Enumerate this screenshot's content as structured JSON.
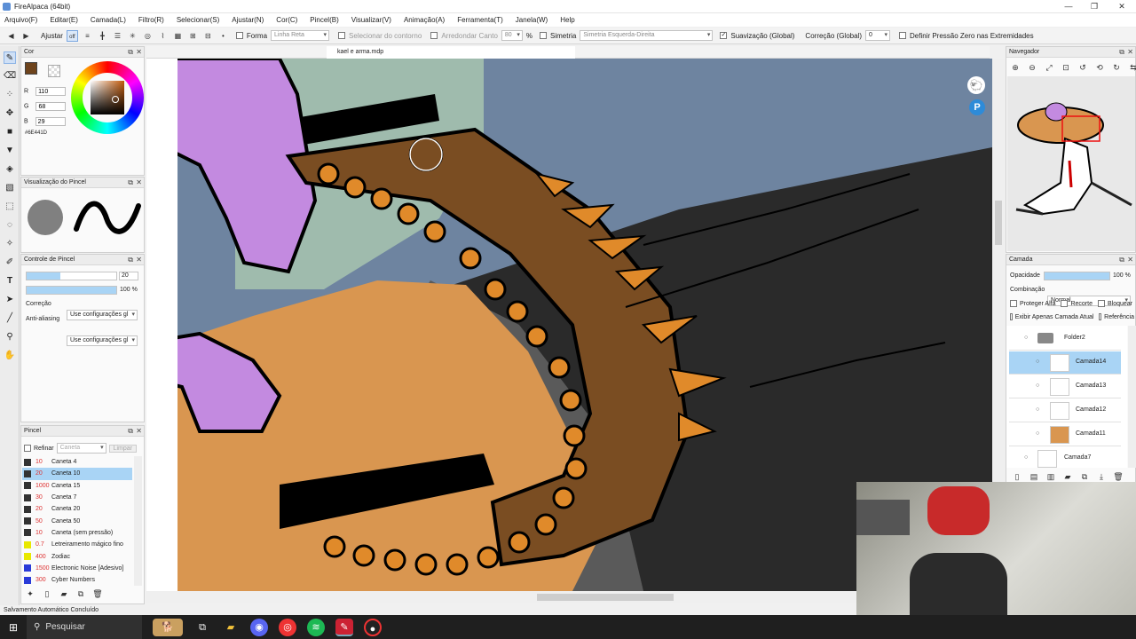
{
  "app": {
    "title": "FireAlpaca (64bit)"
  },
  "menu": [
    "Arquivo(F)",
    "Editar(E)",
    "Camada(L)",
    "Filtro(R)",
    "Selecionar(S)",
    "Ajustar(N)",
    "Cor(C)",
    "Pincel(B)",
    "Visualizar(V)",
    "Animação(A)",
    "Ferramenta(T)",
    "Janela(W)",
    "Help"
  ],
  "toolbar": {
    "ajustar": "Ajustar",
    "off": "off",
    "forma_label": "Forma",
    "forma_value": "Linha Reta",
    "selecionar_contorno": "Selecionar do contorno",
    "arredondar_canto": "Arredondar Canto",
    "arredondar_value": "80",
    "percent": "%",
    "simetria": "Simetria",
    "simetria_value": "Simetria Esquerda-Direita",
    "suavizacao": "Suavização (Global)",
    "correcao": "Correção (Global)",
    "correcao_value": "0",
    "pressao": "Definir Pressão Zero nas Extremidades"
  },
  "color_panel": {
    "title": "Cor",
    "r": "110",
    "g": "68",
    "b": "29",
    "hex": "#6E441D",
    "swatch": "#6e441d"
  },
  "brush_view": {
    "title": "Visualização do Pincel"
  },
  "brush_control": {
    "title": "Controle de Pincel",
    "size": "20",
    "opacity": "100 %",
    "correcao": "Correção",
    "correcao_value": "Use configurações gl",
    "antialias": "Anti-aliasing",
    "antialias_value": "Use configurações gl"
  },
  "pincel": {
    "title": "Pincel",
    "refinar": "Refinar",
    "search_placeholder": "Caneta",
    "limpar": "Limpar",
    "items": [
      {
        "size": "10",
        "name": "Caneta 4",
        "color": "#222222"
      },
      {
        "size": "20",
        "name": "Caneta 10",
        "color": "#222222"
      },
      {
        "size": "1000",
        "name": "Caneta 15",
        "color": "#222222"
      },
      {
        "size": "30",
        "name": "Caneta 7",
        "color": "#222222"
      },
      {
        "size": "20",
        "name": "Caneta 20",
        "color": "#222222"
      },
      {
        "size": "50",
        "name": "Caneta 50",
        "color": "#222222"
      },
      {
        "size": "10",
        "name": "Caneta (sem pressão)",
        "color": "#222222"
      },
      {
        "size": "0.7",
        "name": "Letreiramento mágico fino",
        "color": "#e8e800"
      },
      {
        "size": "400",
        "name": "Zodiac",
        "color": "#e8e800"
      },
      {
        "size": "1500",
        "name": "Electronic Noise [Adesivo]",
        "color": "#2a3bd8"
      },
      {
        "size": "300",
        "name": "Cyber Numbers",
        "color": "#2a3bd8"
      }
    ]
  },
  "document": {
    "tab": "kael e arma.mdp"
  },
  "navigator": {
    "title": "Navegador"
  },
  "layer_panel": {
    "title": "Camada",
    "opacity_label": "Opacidade",
    "opacity_value": "100 %",
    "blend_label": "Combinação",
    "blend_value": "Normal",
    "proteger": "Proteger Alfa",
    "recorte": "Recorte",
    "bloquear": "Bloquear",
    "exibir": "Exibir Apenas Camada Atual",
    "referencia": "Referência",
    "folder": "Folder2",
    "layers": [
      "Camada14",
      "Camada13",
      "Camada12",
      "Camada11",
      "Camada7"
    ]
  },
  "status": "Salvamento Automático Concluído",
  "taskbar": {
    "search": "Pesquisar"
  }
}
